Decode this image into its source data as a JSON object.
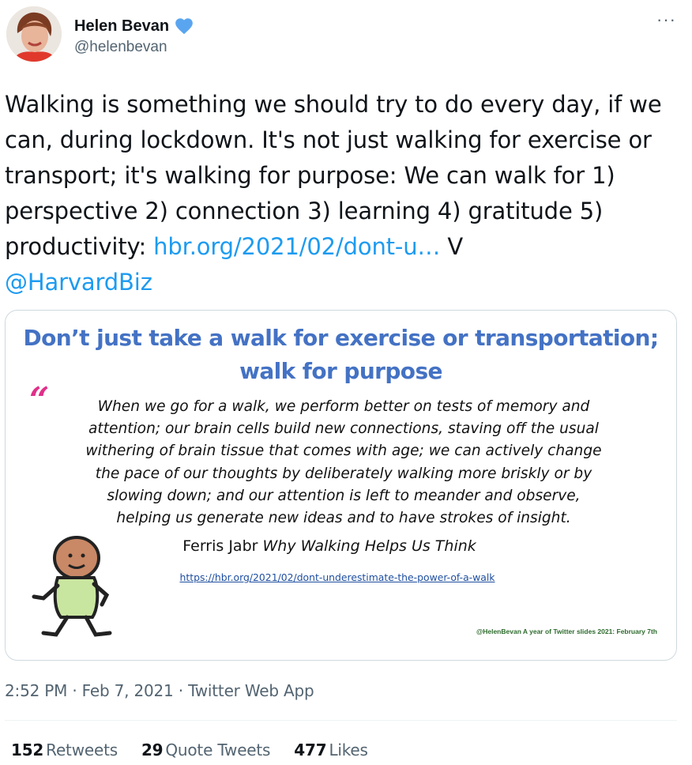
{
  "author": {
    "name": "Helen Bevan",
    "handle": "@helenbevan",
    "avatar_icon": "avatar-photo"
  },
  "more_label": "···",
  "tweet": {
    "text_main": "Walking is something we should try to do every day, if we can, during lockdown. It's not just walking for exercise or transport; it's walking for purpose: We can walk for 1) perspective 2) connection 3) learning 4) gratitude 5) productivity: ",
    "link_text": "hbr.org/2021/02/dont-u…",
    "text_after_link": " V",
    "mention": "@HarvardBiz"
  },
  "media": {
    "title_line1": "Don’t just take a walk for exercise or transportation;",
    "title_line2": "walk for purpose",
    "quote_mark": "“",
    "quote_lines": [
      "When we go for a walk, we perform better on tests of memory and",
      "attention; our brain cells build new connections, staving off the usual",
      "withering of brain tissue that comes with age; we can actively change",
      "the pace of our thoughts by deliberately walking more briskly or by",
      "slowing down; and our attention is left to meander and observe,",
      "helping us generate new ideas and to have strokes of insight."
    ],
    "author_name": "Ferris Jabr ",
    "author_work": "Why Walking Helps Us Think",
    "url": "https://hbr.org/2021/02/dont-underestimate-the-power-of-a-walk",
    "credit": "@HelenBevan A year of Twitter slides 2021: February 7th"
  },
  "meta": {
    "time": "2:52 PM",
    "sep1": " · ",
    "date": "Feb 7, 2021",
    "sep2": " · ",
    "source": "Twitter Web App"
  },
  "stats": {
    "retweets_count": "152",
    "retweets_label": "Retweets",
    "quotes_count": "29",
    "quotes_label": "Quote Tweets",
    "likes_count": "477",
    "likes_label": "Likes"
  },
  "colors": {
    "link": "#1d9bf0",
    "slide_title": "#4472c4",
    "quote_mark": "#e0308a",
    "verified": "#1d9bf0"
  }
}
